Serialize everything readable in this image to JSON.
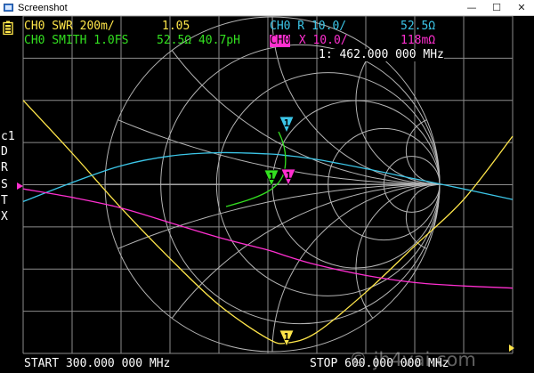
{
  "window": {
    "title": "Screenshot",
    "minimize_glyph": "—",
    "maximize_glyph": "☐",
    "close_glyph": "✕"
  },
  "colors": {
    "background": "#000000",
    "grid": "#8c8c8c",
    "smith": "#b4b4b4",
    "swr": "#ffe64a",
    "smith_trace": "#33e020",
    "resistance": "#3cc6e8",
    "reactance": "#ff2fd0",
    "text": "#ffffff"
  },
  "traces": {
    "ch0_swr": {
      "label": "CH0 SWR 200m/",
      "value": "1.05"
    },
    "ch0_smith": {
      "label": "CH0 SMITH 1.0FS",
      "value": "52.5Ω 40.7pH"
    },
    "ch0_r": {
      "label": "CH0 R 10.0/",
      "value": "52.5Ω"
    },
    "ch0_x": {
      "channel": "CH0",
      "label": " X 10.0/",
      "value": "118mΩ"
    }
  },
  "marker": {
    "readout": "1: 462.000 000 MHz",
    "label": "1"
  },
  "side_menu": [
    "c1",
    "D",
    "R",
    "S",
    "T",
    "X"
  ],
  "footer": {
    "start": "START 300.000 000 MHz",
    "stop": "STOP 600.000 000 MHz"
  },
  "watermark": "© jh4vai.com",
  "chart_data": {
    "type": "line",
    "x": {
      "start_mhz": 300.0,
      "stop_mhz": 600.0,
      "divisions": 10
    },
    "series": [
      {
        "name": "CH0 SWR 200m/",
        "x_mhz": [
          300,
          330,
          360,
          390,
          420,
          450,
          462,
          480,
          510,
          540,
          570,
          600
        ],
        "values": [
          2.2,
          1.95,
          1.69,
          1.45,
          1.23,
          1.07,
          1.05,
          1.1,
          1.29,
          1.51,
          1.73,
          2.03
        ]
      },
      {
        "name": "CH0 R 10.0/",
        "x_mhz": [
          300,
          330,
          360,
          390,
          420,
          450,
          462,
          480,
          510,
          540,
          570,
          600
        ],
        "values": [
          36.0,
          40.5,
          44.5,
          46.8,
          47.6,
          47.3,
          46.9,
          46.0,
          43.8,
          41.4,
          39.0,
          36.5
        ]
      },
      {
        "name": "CH0 X 10.0/",
        "x_mhz": [
          300,
          330,
          360,
          390,
          420,
          450,
          462,
          480,
          510,
          540,
          570,
          600
        ],
        "values": [
          39.0,
          37.0,
          34.5,
          31.0,
          27.5,
          24.5,
          23.0,
          21.0,
          18.5,
          16.8,
          16.0,
          15.5
        ]
      }
    ]
  }
}
